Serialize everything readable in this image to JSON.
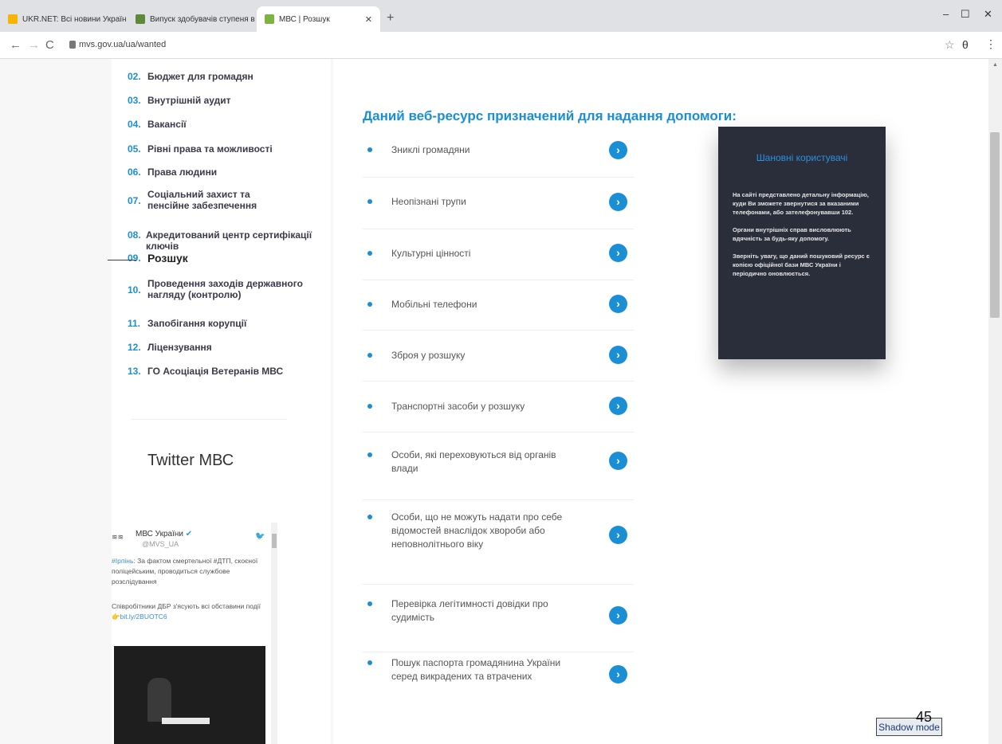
{
  "browser": {
    "tabs": [
      {
        "label": "UKR.NET: Всі новини України, о",
        "close": "✕",
        "favicon_color": "#f5b400",
        "active": false
      },
      {
        "label": "Випуск здобувачів ступеня ви",
        "close": "✕",
        "favicon_color": "#5c8a3a",
        "active": false
      },
      {
        "label": "МВС | Розшук",
        "close": "✕",
        "favicon_color": "#7cb342",
        "active": true
      }
    ],
    "new_tab": "+",
    "url": "mvs.gov.ua/ua/wanted",
    "controls": {
      "minimize": "–",
      "maximize": "☐",
      "close": "✕"
    },
    "nav": {
      "back": "←",
      "forward": "→",
      "reload": "C"
    },
    "star": "☆",
    "profile": "θ",
    "more": "⋮"
  },
  "sidebar": {
    "items": [
      {
        "num": "02.",
        "label": "Бюджет для громадян"
      },
      {
        "num": "03.",
        "label": "Внутрішній аудит"
      },
      {
        "num": "04.",
        "label": "Вакансії"
      },
      {
        "num": "05.",
        "label": "Рівні права та можливості"
      },
      {
        "num": "06.",
        "label": "Права людини"
      },
      {
        "num": "07.",
        "label": "Соціальний захист та пенсійне забезпечення"
      },
      {
        "num": "08.",
        "label": "Акредитований центр сертифікації ключів"
      },
      {
        "num": "09.",
        "label": "Розшук",
        "active": true
      },
      {
        "num": "10.",
        "label": "Проведення заходів державного нагляду (контролю)"
      },
      {
        "num": "11.",
        "label": "Запобігання корупції"
      },
      {
        "num": "12.",
        "label": "Ліцензування"
      },
      {
        "num": "13.",
        "label": "ГО Асоціація Ветеранів МВС"
      }
    ]
  },
  "twitter": {
    "title": "Twitter МВС",
    "tweet": {
      "avatar_text": "≋≋",
      "name": "МВС України",
      "handle": "@MVS_UA",
      "hashtag": "#Ірпінь",
      "text": ": За фактом смертельної #ДТП, скоєної поліцейським, проводиться службове розслідування",
      "text2": "Співробітники ДБР з'ясують всі обставини події",
      "link": "bit.ly/2BUOTC6"
    }
  },
  "main": {
    "heading": "Даний веб-ресурс призначений для надання допомоги:",
    "items": [
      "Зниклі громадяни",
      "Неопізнані трупи",
      "Культурні цінності",
      "Мобільні телефони",
      "Зброя у розшуку",
      "Транспортні засоби у розшуку",
      "Особи, які переховуються від органів влади",
      "Особи, що не можуть надати про себе відомостей внаслідок хвороби або неповнолітнього віку",
      "Перевірка легітимності довідки про судимість",
      "Пошук паспорта громадянина України серед викрадених та втрачених"
    ],
    "arrow": "›"
  },
  "notice": {
    "title": "Шановні користувачі",
    "paragraphs": [
      "На сайті представлено детальну інформацію, куди Ви зможете звернутися за вказаними телефонами, або зателефонувавши 102.",
      "Органи внутрішніх справ висловлюють вдячність за будь-яку допомогу.",
      "Зверніть увагу, що даний пошуковий ресурс є копією офіційної бази МВС України і періодично оновлюється."
    ]
  },
  "footer": {
    "shadow_mode": "Shadow mode",
    "page_number": "45"
  }
}
